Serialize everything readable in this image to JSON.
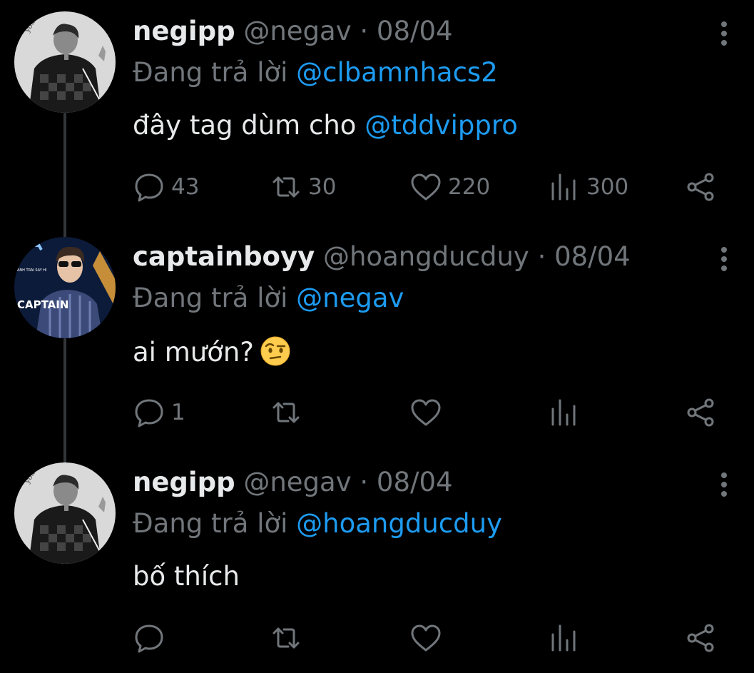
{
  "replying_label": "Đang trả lời",
  "tweets": [
    {
      "name": "negipp",
      "handle": "@negav",
      "separator": "·",
      "date": "08/04",
      "reply_to": "@clbamnhacs2",
      "text": "đây tag dùm cho ",
      "text_mention": "@tddvippro",
      "emoji": "",
      "counts": {
        "reply": "43",
        "retweet": "30",
        "like": "220",
        "views": "300"
      },
      "avatar_text": "you are the apple of my eye"
    },
    {
      "name": "captainboyy",
      "handle": "@hoangducduy",
      "separator": "·",
      "date": "08/04",
      "reply_to": "@negav",
      "text": "ai mướn?",
      "text_mention": "",
      "emoji": "face-with-raised-eyebrow",
      "counts": {
        "reply": "1",
        "retweet": "",
        "like": "",
        "views": ""
      },
      "avatar_text": "CAPTAIN",
      "avatar_subtext": "ANH TRAI SAY HI"
    },
    {
      "name": "negipp",
      "handle": "@negav",
      "separator": "·",
      "date": "08/04",
      "reply_to": "@hoangducduy",
      "text": "bố thích",
      "text_mention": "",
      "emoji": "",
      "counts": {
        "reply": "",
        "retweet": "",
        "like": "",
        "views": ""
      },
      "avatar_text": "you are the apple of my eye"
    }
  ],
  "icons": {
    "reply": "speech-bubble-icon",
    "retweet": "retweet-icon",
    "like": "heart-icon",
    "views": "bar-chart-icon",
    "share": "share-icon",
    "more": "vertical-dots-icon"
  },
  "colors": {
    "background": "#000000",
    "text": "#e7e9ea",
    "muted": "#71767b",
    "accent": "#1d9bf0",
    "thread_line": "#333639"
  }
}
